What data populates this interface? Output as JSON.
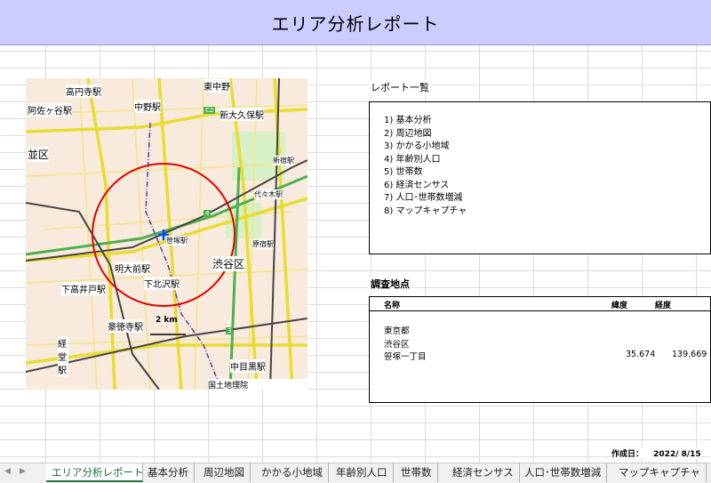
{
  "page_title": "エリア分析レポート",
  "map": {
    "labels": [
      "高円寺駅",
      "東中野",
      "中野駅",
      "新大久保駅",
      "阿佐ヶ谷駅",
      "並区",
      "新宿駅",
      "代々木駅",
      "笹塚駅",
      "明大前駅",
      "渋谷区",
      "原宿駅",
      "下高井戸駅",
      "下北沢駅",
      "豪徳寺駅",
      "経堂駅",
      "中目黒駅"
    ],
    "scale": "2 km",
    "attribution": "国土地理院　ZoomLevel=13",
    "route_badges": [
      "4",
      "3",
      "C2"
    ]
  },
  "report_list": {
    "title": "レポート一覧",
    "items": [
      "1) 基本分析",
      "2) 周辺地図",
      "3) かかる小地域",
      "4) 年齢別人口",
      "5) 世帯数",
      "6) 経済センサス",
      "7) 人口･世帯数増減",
      "8) マップキャプチャ"
    ]
  },
  "location": {
    "title": "調査地点",
    "headers": {
      "name": "名称",
      "lat": "緯度",
      "lon": "経度"
    },
    "rows": [
      "東京都",
      "渋谷区",
      "笹塚一丁目"
    ],
    "lat": "35.674",
    "lon": "139.669"
  },
  "created": {
    "label": "作成日：",
    "date": "2022/ 8/15"
  },
  "tabs": [
    "エリア分析レポート",
    "基本分析",
    "周辺地図",
    "かかる小地域",
    "年齢別人口",
    "世帯数",
    "経済センサス",
    "人口･世帯数増減",
    "マップキャプチャ"
  ],
  "tab_nav": {
    "prev": "◀",
    "next": "▶"
  }
}
